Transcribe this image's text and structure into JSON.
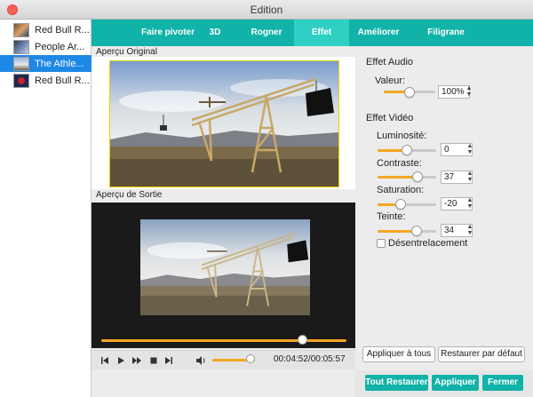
{
  "window": {
    "title": "Edition"
  },
  "files": [
    {
      "name": "Red Bull R..."
    },
    {
      "name": "People Ar..."
    },
    {
      "name": "The Athle..."
    },
    {
      "name": "Red Bull R..."
    }
  ],
  "tabs": [
    {
      "label": "Faire pivoter"
    },
    {
      "label": "3D"
    },
    {
      "label": "Rogner"
    },
    {
      "label": "Effet"
    },
    {
      "label": "Améliorer"
    },
    {
      "label": "Filigrane"
    }
  ],
  "preview": {
    "original_label": "Aperçu Original",
    "output_label": "Aperçu de Sortie"
  },
  "playback": {
    "progress": 0.82,
    "volume": 0.9,
    "timecode": "00:04:52/00:05:57"
  },
  "audio": {
    "section_title": "Effet Audio",
    "value_label": "Valeur:",
    "value": "100%",
    "value_level": 0.5
  },
  "video": {
    "section_title": "Effet Vidéo",
    "brightness_label": "Luminosité:",
    "brightness": "0",
    "brightness_level": 0.5,
    "contrast_label": "Contraste:",
    "contrast": "37",
    "contrast_level": 0.68,
    "saturation_label": "Saturation:",
    "saturation": "-20",
    "saturation_level": 0.4,
    "hue_label": "Teinte:",
    "hue": "34",
    "hue_level": 0.67,
    "deinterlace_label": "Désentrelacement"
  },
  "buttons": {
    "apply_all": "Appliquer à tous",
    "restore_default": "Restaurer par défaut",
    "restore_all": "Tout Restaurer",
    "apply": "Appliquer",
    "close": "Fermer"
  },
  "colors": {
    "accent": "#11b2a8",
    "active_tab": "#2fd0c3",
    "slider": "#f5a623",
    "selection": "#1e88e5"
  }
}
